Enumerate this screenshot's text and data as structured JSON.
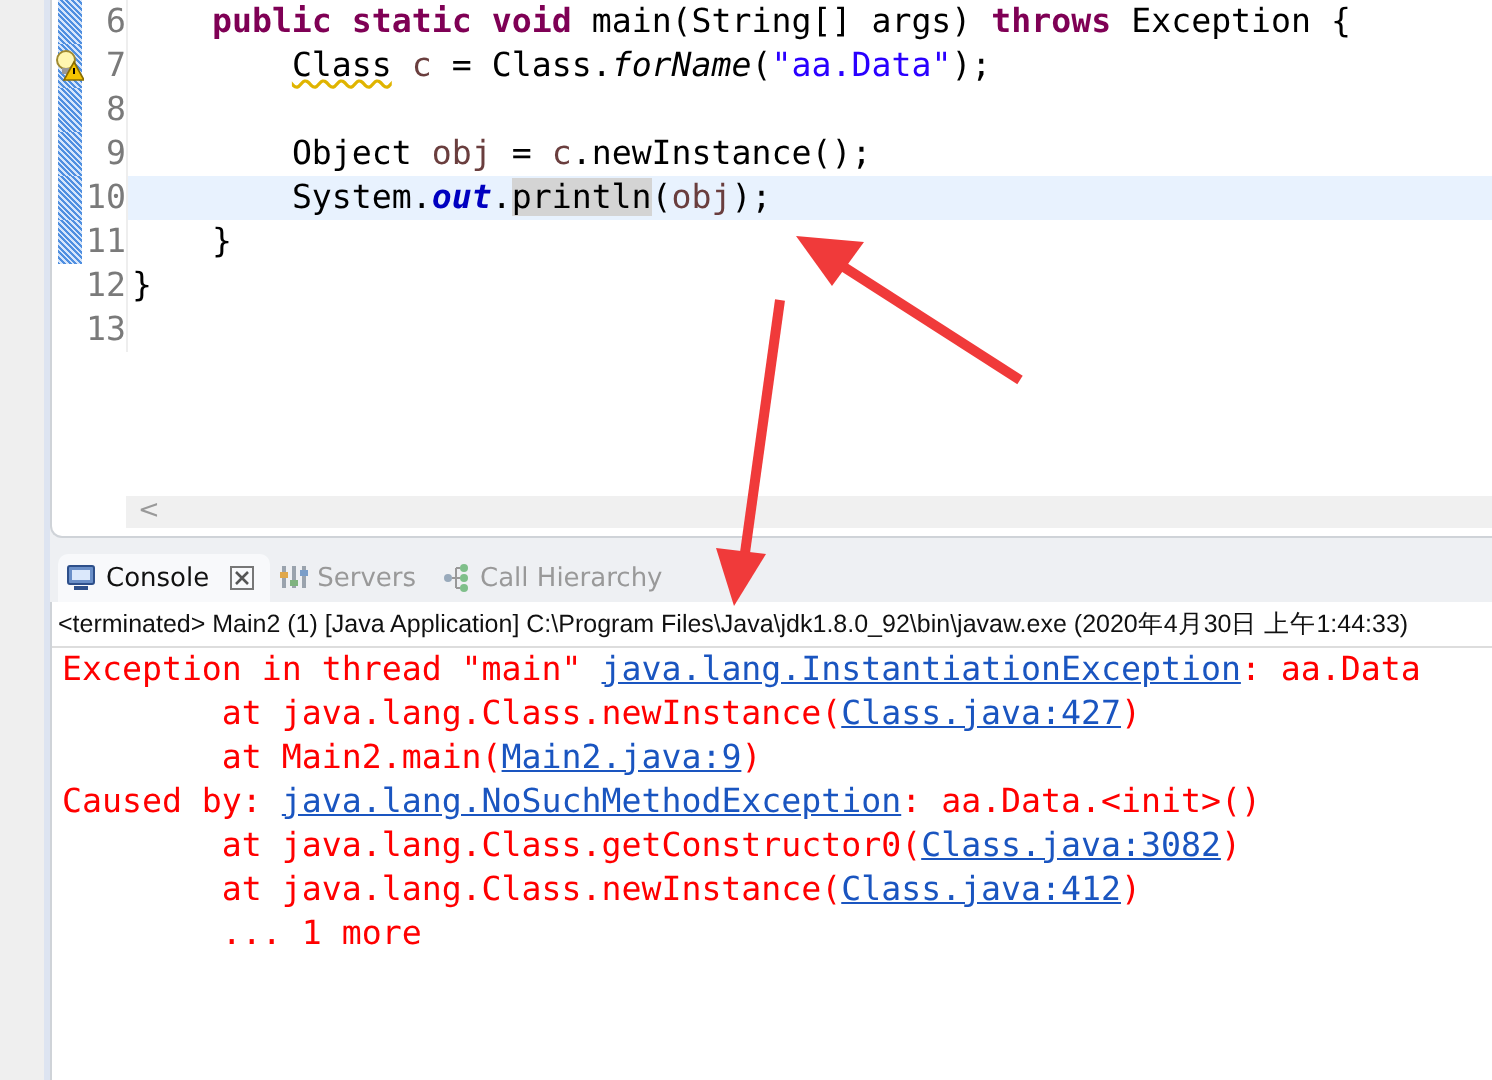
{
  "editor": {
    "lines": [
      {
        "number": "6",
        "changed": true,
        "warning": false,
        "current": false,
        "tokens": [
          {
            "text": "    public",
            "kind": "keyword"
          },
          {
            "text": " static",
            "kind": "keyword"
          },
          {
            "text": " void",
            "kind": "keyword"
          },
          {
            "text": " main(String[] args) ",
            "kind": "plain"
          },
          {
            "text": "throws",
            "kind": "keyword"
          },
          {
            "text": " Exception {",
            "kind": "plain"
          }
        ]
      },
      {
        "number": "7",
        "changed": true,
        "warning": true,
        "current": false,
        "tokens": [
          {
            "text": "        Class",
            "kind": "warn"
          },
          {
            "text": " c",
            "kind": "local"
          },
          {
            "text": " = Class.",
            "kind": "plain"
          },
          {
            "text": "forName",
            "kind": "static"
          },
          {
            "text": "(",
            "kind": "plain"
          },
          {
            "text": "\"aa.Data\"",
            "kind": "string"
          },
          {
            "text": ");",
            "kind": "plain"
          }
        ]
      },
      {
        "number": "8",
        "changed": true,
        "warning": false,
        "current": false
      },
      {
        "number": "9",
        "changed": true,
        "warning": false,
        "current": false,
        "tokens": [
          {
            "text": "        Object ",
            "kind": "plain"
          },
          {
            "text": "obj",
            "kind": "local"
          },
          {
            "text": " = ",
            "kind": "plain"
          },
          {
            "text": "c",
            "kind": "local"
          },
          {
            "text": ".newInstance();",
            "kind": "plain"
          }
        ]
      },
      {
        "number": "10",
        "changed": true,
        "warning": false,
        "current": true,
        "tokens": [
          {
            "text": "        System.",
            "kind": "plain"
          },
          {
            "text": "out",
            "kind": "field"
          },
          {
            "text": ".",
            "kind": "plain"
          },
          {
            "text": "println",
            "kind": "occurrence"
          },
          {
            "text": "(",
            "kind": "plain"
          },
          {
            "text": "obj",
            "kind": "local"
          },
          {
            "text": ");",
            "kind": "plain"
          }
        ]
      },
      {
        "number": "11",
        "changed": true,
        "warning": false,
        "current": false,
        "tokens": [
          {
            "text": "    }",
            "kind": "plain"
          }
        ]
      },
      {
        "number": "12",
        "changed": false,
        "warning": false,
        "current": false,
        "tokens": [
          {
            "text": "}",
            "kind": "plain"
          }
        ]
      },
      {
        "number": "13",
        "changed": false,
        "warning": false,
        "current": false
      }
    ],
    "scroll_left": "<"
  },
  "tabs": [
    {
      "label": "Console",
      "selected": true
    },
    {
      "label": "Servers",
      "selected": false
    },
    {
      "label": "Call Hierarchy",
      "selected": false
    }
  ],
  "console": {
    "status": "<terminated> Main2 (1) [Java Application] C:\\Program Files\\Java\\jdk1.8.0_92\\bin\\javaw.exe (2020年4月30日 上午1:44:33)",
    "lines": [
      [
        {
          "text": "Exception in thread \"main\" ",
          "kind": "text"
        },
        {
          "text": "java.lang.InstantiationException",
          "kind": "link"
        },
        {
          "text": ": aa.Data",
          "kind": "text"
        }
      ],
      [
        {
          "text": "        at java.lang.Class.newInstance(",
          "kind": "text"
        },
        {
          "text": "Class.java:427",
          "kind": "link"
        },
        {
          "text": ")",
          "kind": "text"
        }
      ],
      [
        {
          "text": "        at Main2.main(",
          "kind": "text"
        },
        {
          "text": "Main2.java:9",
          "kind": "link"
        },
        {
          "text": ")",
          "kind": "text"
        }
      ],
      [
        {
          "text": "Caused by: ",
          "kind": "text"
        },
        {
          "text": "java.lang.NoSuchMethodException",
          "kind": "link"
        },
        {
          "text": ": aa.Data.<init>()",
          "kind": "text"
        }
      ],
      [
        {
          "text": "        at java.lang.Class.getConstructor0(",
          "kind": "text"
        },
        {
          "text": "Class.java:3082",
          "kind": "link"
        },
        {
          "text": ")",
          "kind": "text"
        }
      ],
      [
        {
          "text": "        at java.lang.Class.newInstance(",
          "kind": "text"
        },
        {
          "text": "Class.java:412",
          "kind": "link"
        },
        {
          "text": ")",
          "kind": "text"
        }
      ],
      [
        {
          "text": "        ... 1 more",
          "kind": "text"
        }
      ]
    ]
  }
}
